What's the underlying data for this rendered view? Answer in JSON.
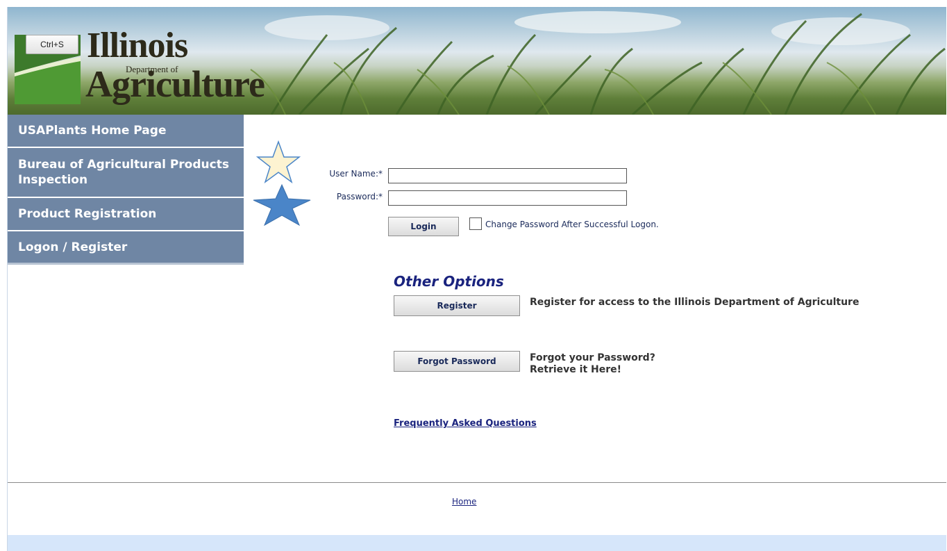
{
  "banner": {
    "ctrl_s_label": "Ctrl+S",
    "logo_line1": "Illinois",
    "logo_line2": "Department of",
    "logo_line3": "Agriculture"
  },
  "sidebar": {
    "items": [
      {
        "label": "USAPlants Home Page"
      },
      {
        "label": "Bureau of Agricultural Products Inspection"
      },
      {
        "label": "Product Registration"
      },
      {
        "label": "Logon / Register"
      }
    ]
  },
  "login": {
    "username_label": "User Name:",
    "password_label": "Password:",
    "required_marker": "*",
    "username_value": "",
    "password_value": "",
    "login_button": "Login",
    "change_password_checked": false,
    "change_password_label": "Change Password After Successful Logon."
  },
  "other_options": {
    "title": "Other Options",
    "register_button": "Register",
    "register_desc": "Register for access to the Illinois Department of Agriculture",
    "forgot_button": "Forgot Password",
    "forgot_desc_line1": "Forgot your Password?",
    "forgot_desc_line2": "Retrieve it Here!",
    "faq_link": "Frequently Asked Questions"
  },
  "footer": {
    "home_link": "Home"
  },
  "colors": {
    "nav_bg": "#6f86a4",
    "star_light": "#fdf3d1",
    "star_dark": "#4a85c8",
    "link": "#1a237e"
  }
}
